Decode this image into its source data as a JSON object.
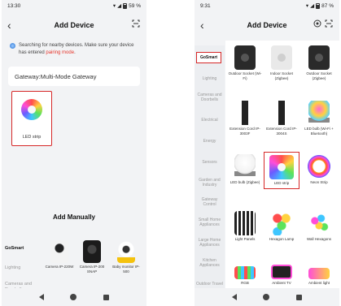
{
  "left": {
    "status": {
      "time": "13:30",
      "battery": "59 %"
    },
    "header": {
      "title": "Add Device"
    },
    "notice": {
      "text": "Searching for nearby devices. Make sure your device has entered",
      "highlight": "pairing mode",
      "end": "."
    },
    "gateway": "Gateway:Multi-Mode Gateway",
    "found_device": {
      "label": "LED strip"
    },
    "add_manually": "Add Manually",
    "categories": [
      "GoSmart",
      "Lighting",
      "Cameras and Doorbells"
    ],
    "devices": [
      {
        "label": "Camera IP-220W"
      },
      {
        "label": "Camera IP-200 SNAP"
      },
      {
        "label": "Baby monitor IP-500"
      }
    ]
  },
  "right": {
    "status": {
      "time": "9:31",
      "battery": "87 %"
    },
    "header": {
      "title": "Add Device"
    },
    "categories": [
      "GoSmart",
      "Lighting",
      "Cameras and Doorbells",
      "Electrical",
      "Energy",
      "Sensors",
      "Garden and Industry",
      "Gateway Control",
      "Small Home Appliances",
      "Large Home Appliances",
      "Kitchen Appliances",
      "Outdoor Travel"
    ],
    "items": [
      {
        "label": "Outdoor Socket (Wi-Fi)"
      },
      {
        "label": "Indoor Socket (Zigbee)"
      },
      {
        "label": "Outdoor Socket (Zigbee)"
      },
      {
        "label": "Extension Cord IP-3003F"
      },
      {
        "label": "Extension Cord IP-3004S"
      },
      {
        "label": "LED bulb (Wi-Fi + Bluetooth)"
      },
      {
        "label": "LED bulb (Zigbee)"
      },
      {
        "label": "LED strip"
      },
      {
        "label": "Neon Strip"
      },
      {
        "label": "Light Panels"
      },
      {
        "label": "Hexagon Lamp"
      },
      {
        "label": "Wall Hexagons"
      },
      {
        "label": "RGB"
      },
      {
        "label": "Ambient TV"
      },
      {
        "label": "Ambient light"
      }
    ]
  }
}
